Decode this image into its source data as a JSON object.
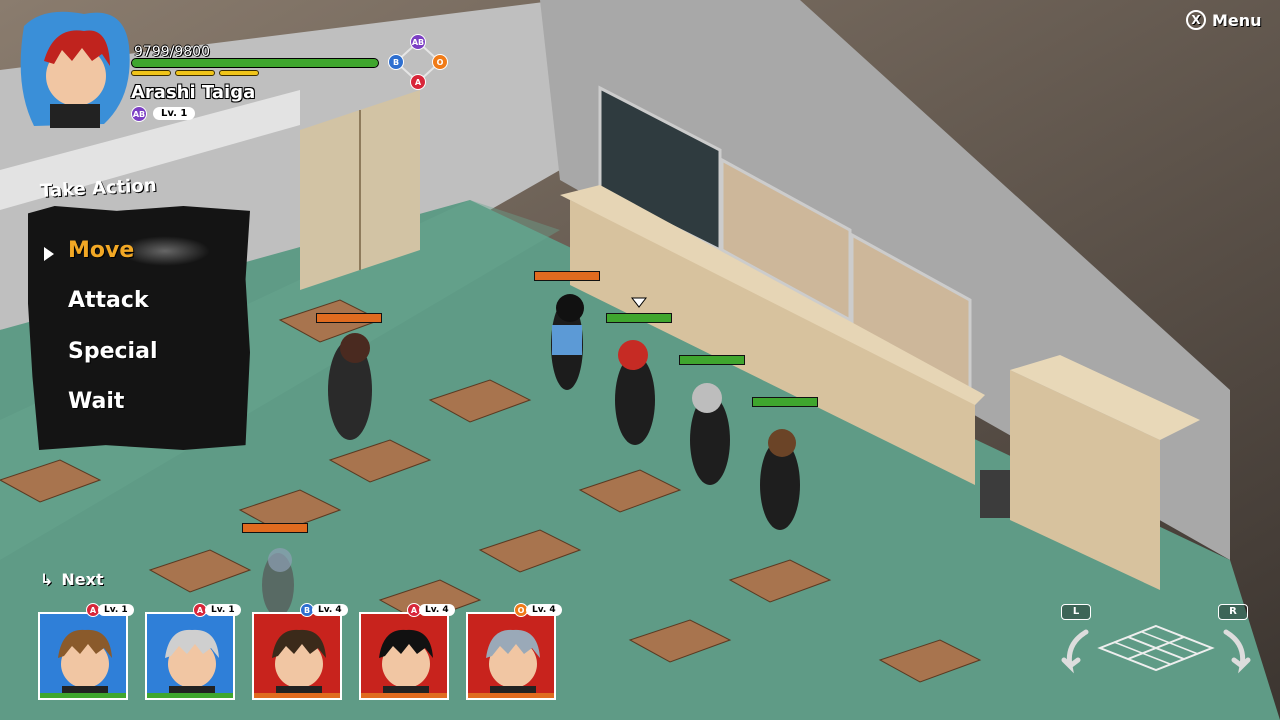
{
  "player": {
    "hp_text": "9799/9800",
    "hp_fraction": 0.9999,
    "name": "Arashi Taiga",
    "blood_type": "AB",
    "level": "Lv. 1",
    "ap_segments": 3
  },
  "stat_diamond": {
    "top": "AB",
    "left": "B",
    "right": "O",
    "bottom": "A"
  },
  "menu": {
    "label": "Menu",
    "key": "X"
  },
  "action_menu": {
    "title": "Take Action",
    "items": [
      "Move",
      "Attack",
      "Special",
      "Wait"
    ],
    "selected_index": 0
  },
  "turn_order": {
    "label": "Next",
    "cards": [
      {
        "blood": "A",
        "level": "Lv. 1",
        "bg": "#2f7fd8",
        "hair": "#8a5a2b",
        "hp_color": "#3fa62e"
      },
      {
        "blood": "A",
        "level": "Lv. 1",
        "bg": "#2f7fd8",
        "hair": "#cfcfcf",
        "hp_color": "#3fa62e"
      },
      {
        "blood": "B",
        "level": "Lv. 4",
        "bg": "#c8231d",
        "hair": "#3b2a1a",
        "hp_color": "#e06b1f"
      },
      {
        "blood": "A",
        "level": "Lv. 4",
        "bg": "#c8231d",
        "hair": "#111111",
        "hp_color": "#e06b1f"
      },
      {
        "blood": "O",
        "level": "Lv. 4",
        "bg": "#c8231d",
        "hair": "#9aa9b8",
        "hp_color": "#e06b1f"
      }
    ]
  },
  "camera": {
    "left_key": "L",
    "right_key": "R"
  },
  "colors": {
    "ally_hp": "#3fa62e",
    "enemy_hp": "#e06b1f",
    "blood_A": "#d8263a",
    "blood_B": "#2e6fd0",
    "blood_AB": "#7c3fc4",
    "blood_O": "#f07b18",
    "selected": "#f2a825"
  }
}
